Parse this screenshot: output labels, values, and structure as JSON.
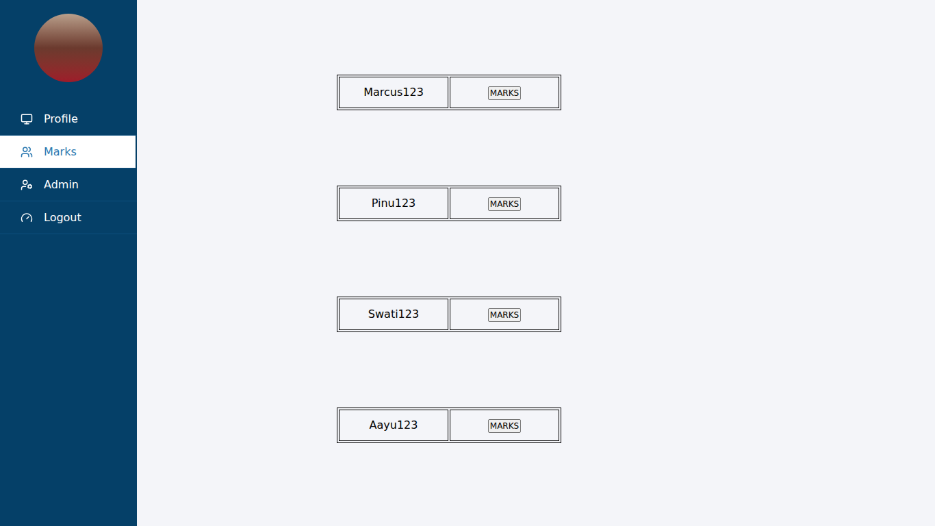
{
  "sidebar": {
    "items": [
      {
        "label": "Profile",
        "selected": false
      },
      {
        "label": "Marks",
        "selected": true
      },
      {
        "label": "Admin",
        "selected": false
      },
      {
        "label": "Logout",
        "selected": false
      }
    ]
  },
  "students": [
    {
      "name": "Marcus123",
      "button": "MARKS"
    },
    {
      "name": "Pinu123",
      "button": "MARKS"
    },
    {
      "name": "Swati123",
      "button": "MARKS"
    },
    {
      "name": "Aayu123",
      "button": "MARKS"
    }
  ]
}
